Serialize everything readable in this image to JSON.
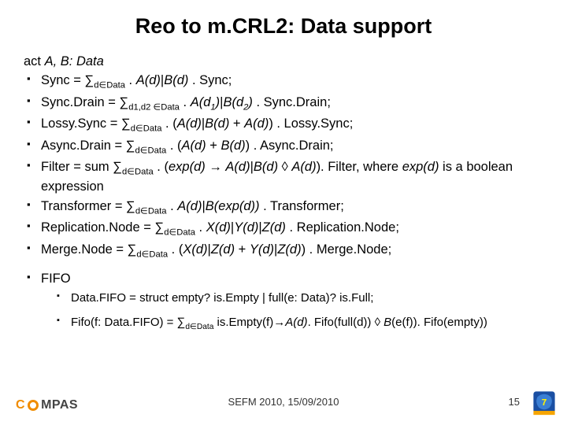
{
  "title": "Reo to m.CRL2: Data support",
  "act_line_html": "act <span class='ital'>A, B: Data</span>",
  "bullets": [
    "Sync = ∑<span class='sub-txt'>d∈Data</span> . <span class='ital'>A(d)</span>|<span class='ital'>B(d)</span> . Sync;",
    "Sync.Drain = ∑<span class='sub-txt'>d1,d2 ∈Data</span> . <span class='ital'>A(d<span class='sub-txt'>1</span>)</span>|<span class='ital'>B(d<span class='sub-txt'>2</span>)</span> . Sync.Drain;",
    "Lossy.Sync = ∑<span class='sub-txt'>d∈Data</span> . (<span class='ital'>A(d)</span>|<span class='ital'>B(d)</span> + <span class='ital'>A(d)</span>) . Lossy.Sync;",
    "Async.Drain = ∑<span class='sub-txt'>d∈Data</span> . (<span class='ital'>A(d)</span> + <span class='ital'>B(d)</span>) . Async.Drain;",
    "Filter = sum ∑<span class='sub-txt'>d∈Data</span> . (<span class='ital'>exp(d)</span> → <span class='ital'>A(d)</span>|<span class='ital'>B(d)</span> ◊ <span class='ital'>A(d)</span>). Filter, where <span class='ital'>exp(d)</span> is a boolean expression",
    "Transformer = ∑<span class='sub-txt'>d∈Data</span> . <span class='ital'>A(d)</span>|<span class='ital'>B(exp(d))</span> . Transformer;",
    "Replication.Node = ∑<span class='sub-txt'>d∈Data</span> . <span class='ital'>X(d)</span>|<span class='ital'>Y(d)</span>|<span class='ital'>Z(d)</span> . Replication.Node;",
    "Merge.Node = ∑<span class='sub-txt'>d∈Data</span> . (<span class='ital'>X(d)</span>|<span class='ital'>Z(d)</span> + <span class='ital'>Y(d)</span>|<span class='ital'>Z(d)</span>) . Merge.Node;"
  ],
  "fifo_label": "FIFO",
  "fifo_sub": [
    "Data.FIFO = struct empty? is.Empty | full(e: Data)? is.Full;",
    "Fifo(f: Data.FIFO) = ∑<span class='sub-txt'>d∈Data</span> is.Empty(f)→<span class='ital'>A(d)</span>. Fifo(full(d)) ◊ <span class='ital'>B</span>(e(f)). Fifo(empty))"
  ],
  "footer": {
    "venue": "SEFM 2010, 15/09/2010",
    "page": "15"
  },
  "logo_left": {
    "text_parts": [
      "C",
      "MPAS"
    ]
  },
  "logo_right": {
    "name": "fp7-logo"
  }
}
